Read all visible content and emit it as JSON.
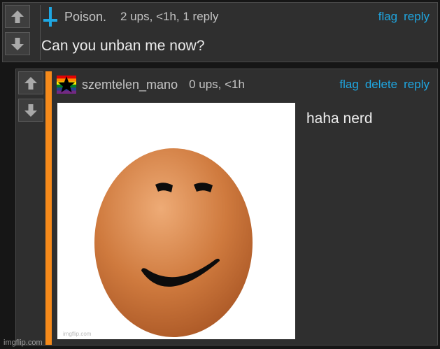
{
  "comments": [
    {
      "username": "Poison.",
      "meta": "2 ups, <1h, 1 reply",
      "actions": [
        "flag",
        "reply"
      ],
      "text": "Can you unban me now?",
      "icon": "blue-cross-icon"
    },
    {
      "username": "szemtelen_mano",
      "meta": "0 ups, <1h",
      "actions": [
        "flag",
        "delete",
        "reply"
      ],
      "text": "haha nerd",
      "icon": "rainbow-star-flag-icon",
      "image_watermark": "imgflip.com"
    }
  ],
  "footer": {
    "watermark": "imgflip.com"
  },
  "colors": {
    "accent": "#f68a1a",
    "link": "#1fa7e2",
    "panel": "#2f2f2f",
    "background": "#161616"
  }
}
